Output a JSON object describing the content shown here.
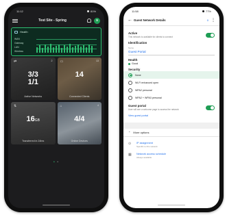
{
  "left": {
    "status": {
      "time": "11:12",
      "battery": "81%"
    },
    "header": {
      "title": "Test Site - Spring",
      "avatar": "s"
    },
    "health_card": {
      "title": "Health",
      "rows": [
        "WAN",
        "Gateway",
        "LAN",
        "Wireless"
      ]
    },
    "tiles": [
      {
        "icon": "network-icon",
        "badge": "2",
        "value": "3/3\n1/1",
        "caption": "Active Networks"
      },
      {
        "icon": "clients-icon",
        "badge": "13",
        "value": "14",
        "caption": "Connected Clients"
      },
      {
        "icon": "transfer-icon",
        "badge": "",
        "value": "16",
        "unit": "GB",
        "caption": "Transferred in 24hrs"
      },
      {
        "icon": "devices-icon",
        "badge": "4",
        "value": "4/4",
        "caption": "Online Devices"
      }
    ],
    "pager": "• •"
  },
  "right": {
    "status": {
      "time": "11:58",
      "battery": "77%"
    },
    "header": {
      "title": "Guest Network Details",
      "badge": "0"
    },
    "active": {
      "label": "Active",
      "sub": "This network is available for clients to connect"
    },
    "identification": {
      "label": "Identification",
      "field_caption": "Name",
      "field_value": "Guest Portal"
    },
    "health": {
      "label": "Health",
      "value": "Good"
    },
    "security": {
      "label": "Security",
      "options": [
        "None",
        "Wi-Fi enhanced open",
        "WPA2 personal",
        "WPA2 + WPA3 personal"
      ],
      "selected": 0
    },
    "guest_portal": {
      "label": "Guest portal",
      "sub": "User will see a welcome page to access the network"
    },
    "view_link": "View guest portal",
    "more_options": "More options",
    "ip": {
      "title": "IP assignment",
      "sub": "Specific to this network"
    },
    "schedule": {
      "title": "Network access schedule",
      "sub": "Always available"
    }
  },
  "colors": {
    "accent_green": "#1f9d55",
    "link_blue": "#1f6feb",
    "dark_bg": "#1c1c1e"
  }
}
